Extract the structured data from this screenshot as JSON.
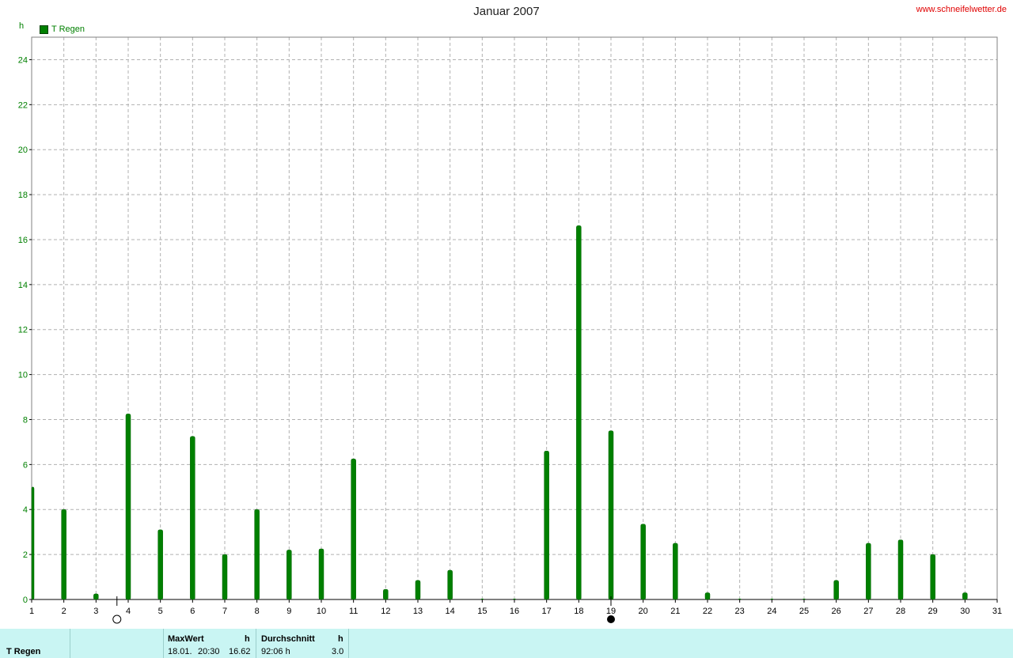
{
  "header": {
    "title": "Januar 2007",
    "site": "www.schneifelwetter.de",
    "unit": "h",
    "legend_label": "T Regen"
  },
  "colors": {
    "bar": "#008000",
    "bar_dark": "#006400",
    "grid": "#b0b0b0",
    "axis_text": "#008000",
    "footer_bg": "#c9f5f3"
  },
  "footer": {
    "series_label": "T Regen",
    "max_header": "MaxWert",
    "max_unit": "h",
    "max_date": "18.01.",
    "max_time": "20:30",
    "max_value": "16.62",
    "avg_header": "Durchschnitt",
    "avg_unit": "h",
    "avg_total": "92:06 h",
    "avg_value": "3.0"
  },
  "chart_data": {
    "type": "bar",
    "title": "Januar 2007",
    "ylabel": "h",
    "xlabel": "",
    "ylim": [
      0,
      25
    ],
    "xlim": [
      1,
      31
    ],
    "x_ticks": [
      1,
      2,
      3,
      4,
      5,
      6,
      7,
      8,
      9,
      10,
      11,
      12,
      13,
      14,
      15,
      16,
      17,
      18,
      19,
      20,
      21,
      22,
      23,
      24,
      25,
      26,
      27,
      28,
      29,
      30,
      31
    ],
    "y_ticks": [
      0,
      2,
      4,
      6,
      8,
      10,
      12,
      14,
      16,
      18,
      20,
      22,
      24
    ],
    "grid": true,
    "legend_placement": "top-left",
    "categories": [
      1,
      2,
      3,
      4,
      5,
      6,
      7,
      8,
      9,
      10,
      11,
      12,
      13,
      14,
      15,
      16,
      17,
      18,
      19,
      20,
      21,
      22,
      23,
      24,
      25,
      26,
      27,
      28,
      29,
      30
    ],
    "series": [
      {
        "name": "T Regen",
        "values": [
          5.0,
          4.0,
          0.25,
          8.25,
          3.1,
          7.25,
          2.0,
          4.0,
          2.2,
          2.25,
          6.25,
          0.45,
          0.85,
          1.3,
          0,
          0,
          6.6,
          16.62,
          7.5,
          3.35,
          2.5,
          0.3,
          0,
          0,
          0,
          0.85,
          2.5,
          2.65,
          2.0,
          0.3
        ]
      }
    ],
    "moon_markers": [
      {
        "day": 3.65,
        "phase": "full"
      },
      {
        "day": 19.0,
        "phase": "new"
      }
    ]
  }
}
